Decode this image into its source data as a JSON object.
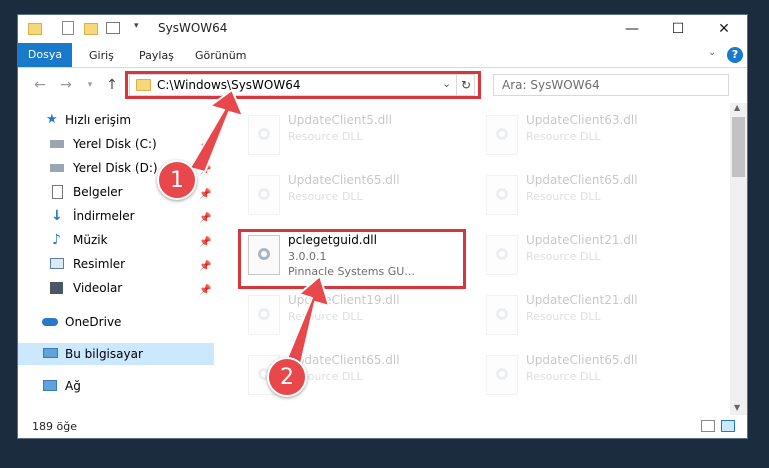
{
  "window": {
    "title": "SysWOW64"
  },
  "ribbon": {
    "tabs": [
      "Dosya",
      "Giriş",
      "Paylaş",
      "Görünüm"
    ]
  },
  "address": {
    "path": "C:\\Windows\\SysWOW64",
    "search_placeholder": "Ara: SysWOW64"
  },
  "nav": {
    "items": [
      {
        "label": "Hızlı erişim"
      },
      {
        "label": "Yerel Disk (C:)"
      },
      {
        "label": "Yerel Disk (D:)"
      },
      {
        "label": "Belgeler"
      },
      {
        "label": "İndirmeler"
      },
      {
        "label": "Müzik"
      },
      {
        "label": "Resimler"
      },
      {
        "label": "Videolar"
      },
      {
        "label": "OneDrive"
      },
      {
        "label": "Bu bilgisayar"
      },
      {
        "label": "Ağ"
      }
    ]
  },
  "files": [
    {
      "name": "UpdateClient5.dll",
      "desc": "Resource DLL"
    },
    {
      "name": "UpdateClient63.dll",
      "desc": "Resource DLL"
    },
    {
      "name": "UpdateClient65.dll",
      "desc": "Resource DLL"
    },
    {
      "name": "UpdateClient65.dll",
      "desc": "Resource DLL"
    },
    {
      "name": "pclegetguid.dll",
      "version": "3.0.0.1",
      "company": "Pinnacle Systems GU..."
    },
    {
      "name": "UpdateClient21.dll",
      "desc": "Resource DLL"
    },
    {
      "name": "UpdateClient19.dll",
      "desc": "Resource DLL"
    },
    {
      "name": "UpdateClient21.dll",
      "desc": "Resource DLL"
    },
    {
      "name": "UpdateClient65.dll",
      "desc": "Resource DLL"
    },
    {
      "name": "UpdateClient65.dll",
      "desc": "Resource DLL"
    }
  ],
  "status": {
    "count": "189 öğe"
  },
  "annotations": {
    "step1": "1",
    "step2": "2"
  },
  "colors": {
    "accent": "#1979ca",
    "highlight": "#d7363c",
    "selected": "#cce8ff"
  }
}
